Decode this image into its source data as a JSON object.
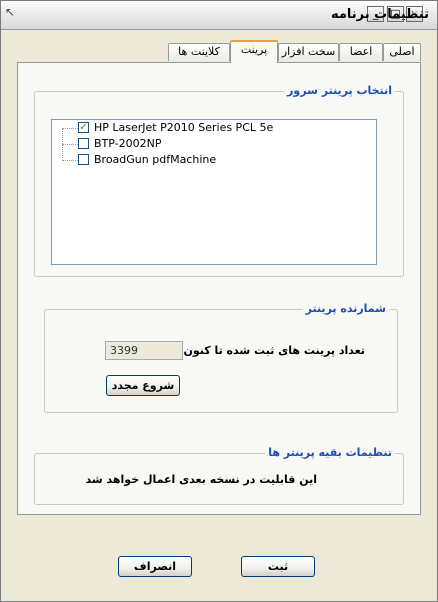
{
  "window": {
    "title": "تنظیمات برنامه"
  },
  "tabs": [
    {
      "label": "اصلی"
    },
    {
      "label": "اعضا"
    },
    {
      "label": "سخت افزار"
    },
    {
      "label": "پرینت"
    },
    {
      "label": "کلاینت ها"
    }
  ],
  "printer_select": {
    "title": "انتخاب پرینتر سرور",
    "printers": [
      {
        "name": "HP LaserJet P2010 Series PCL 5e",
        "checked": true
      },
      {
        "name": "BTP-2002NP",
        "checked": false
      },
      {
        "name": "BroadGun pdfMachine",
        "checked": false
      }
    ]
  },
  "counter": {
    "title": "شمارنده پرینتر",
    "label": "تعداد پرینت های ثبت شده تا کنون",
    "value": "3399",
    "reset_label": "شروع مجدد"
  },
  "other_settings": {
    "title": "تنظیمات بقیه پرینتر ها",
    "message": "این قابلیت در نسخه بعدی اعمال خواهد شد"
  },
  "footer": {
    "save_label": "ثبت",
    "cancel_label": "انصراف"
  }
}
